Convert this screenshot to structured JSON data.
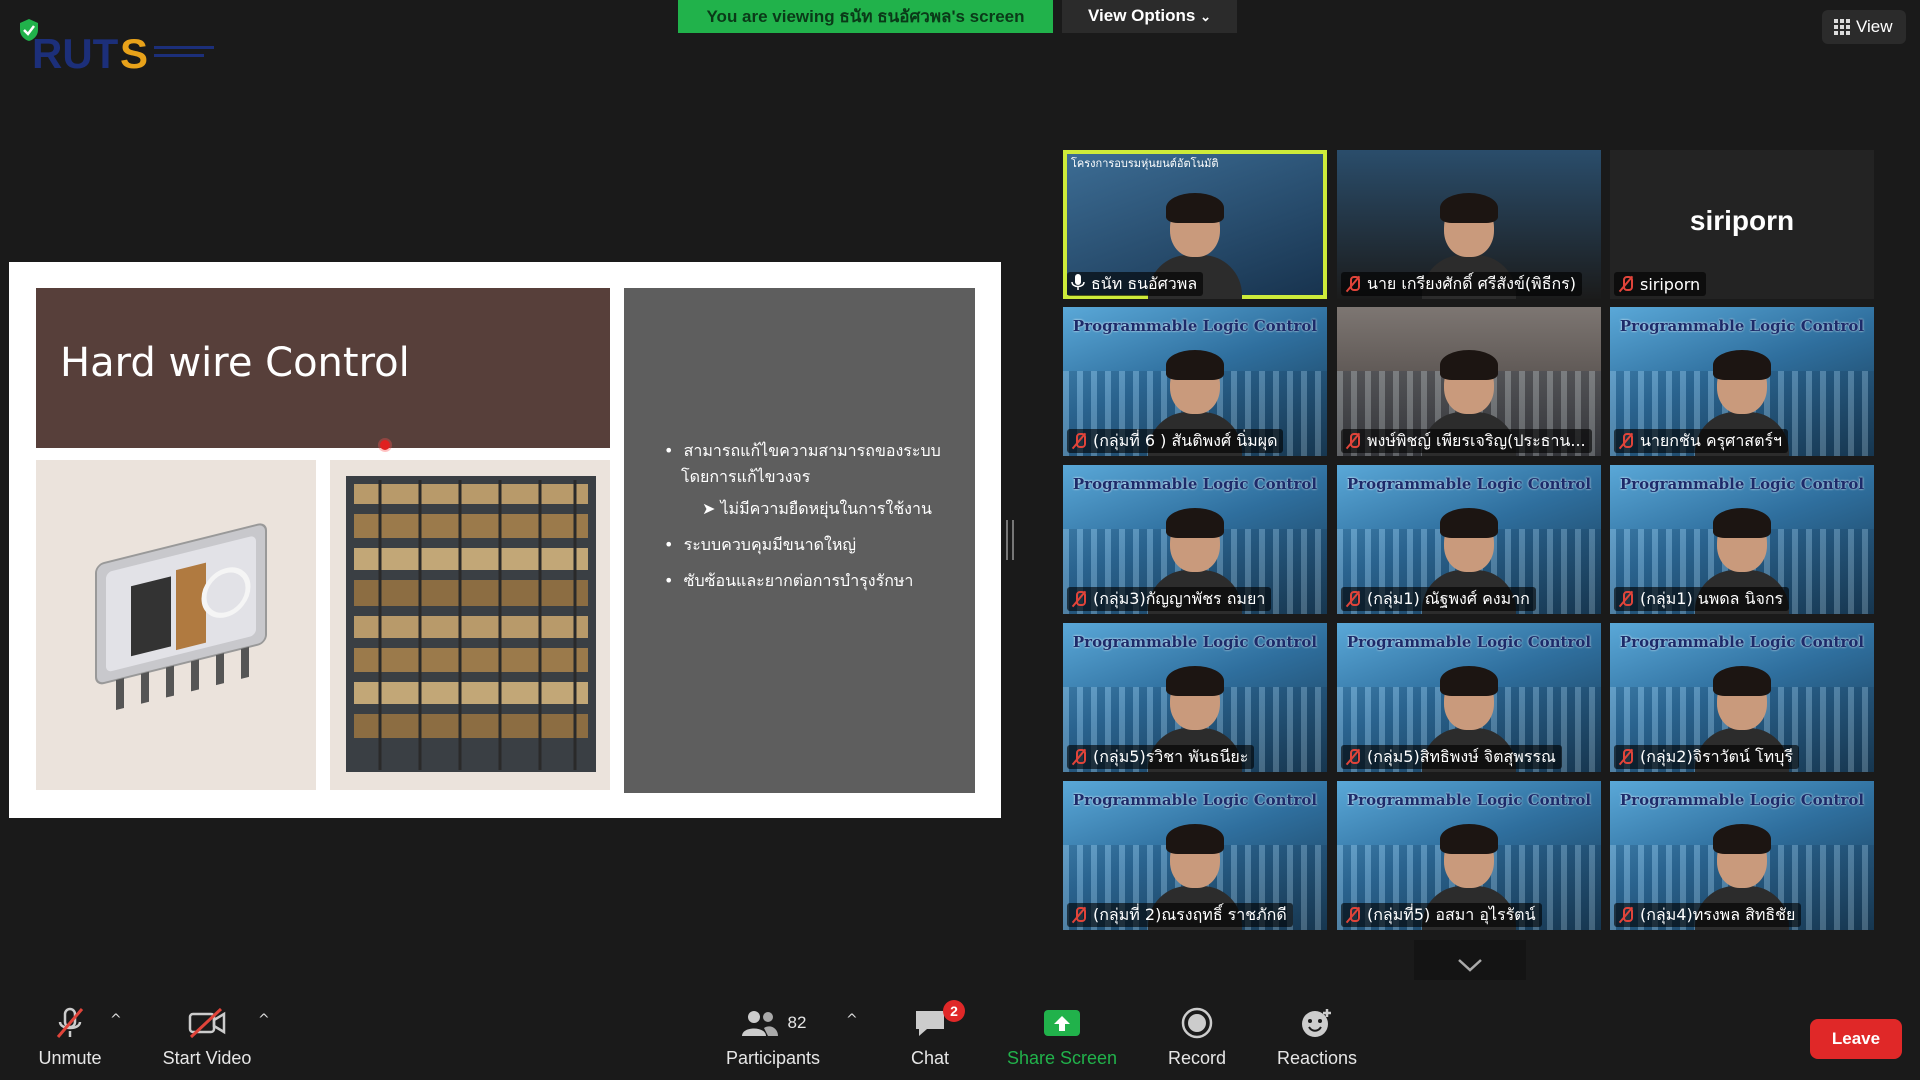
{
  "top": {
    "viewing_banner": "You are viewing ธนัท ธนอัศวพล's screen",
    "view_options": "View Options",
    "view_label": "View",
    "logo_text": "RUTS"
  },
  "slide": {
    "title": "Hard wire Control",
    "bullets": [
      "สามารถแก้ไขความสามารถของระบบ",
      "โดยการแก้ไขวงจร",
      "ไม่มีความยืดหยุ่นในการใช้งาน",
      "ระบบควบคุมมีขนาดใหญ่",
      "ซับซ้อนและยากต่อการบำรุงรักษา"
    ],
    "colors": {
      "title_bg": "#573f3a",
      "panel_bg": "#5e5e5e"
    }
  },
  "gallery": {
    "plc_caption": "Programmable Logic Control",
    "tiles": [
      {
        "name": "ธนัท ธนอัศวพล",
        "muted": false,
        "active": true,
        "overlay": "โครงการอบรมหุ่นยนต์อัตโนมัติ"
      },
      {
        "name": "นาย เกรียงศักดิ์ ศรีสังข์(พิธีกร)",
        "muted": true
      },
      {
        "name": "siriporn",
        "muted": true,
        "video_off": true,
        "display_name": "siriporn"
      },
      {
        "name": "(กลุ่มที่ 6 ) สันติพงศ์ นิ่มผุด",
        "muted": true
      },
      {
        "name": "พงษ์พิชญ์ เพียรเจริญ(ประธาน...",
        "muted": true
      },
      {
        "name": "นายกชัน ครุศาสตร์ฯ",
        "muted": true
      },
      {
        "name": "(กลุ่ม3)กัญญาพัชร ถมยา",
        "muted": true
      },
      {
        "name": "(กลุ่ม1) ณัฐพงศ์ คงมาก",
        "muted": true
      },
      {
        "name": "(กลุ่ม1) นพดล นิจกร",
        "muted": true
      },
      {
        "name": "(กลุ่ม5)รวิชา พันธนียะ",
        "muted": true
      },
      {
        "name": "(กลุ่ม5)สิทธิพงษ์ จิตสุพรรณ",
        "muted": true
      },
      {
        "name": "(กลุ่ม2)จิราวัตน์ โทบุรี",
        "muted": true
      },
      {
        "name": "(กลุ่มที่ 2)ณรงฤทธิ์ ราชภักดี",
        "muted": true
      },
      {
        "name": "(กลุ่มที่5) อสมา อุไรรัตน์",
        "muted": true
      },
      {
        "name": "(กลุ่ม4)ทรงพล สิทธิชัย",
        "muted": true
      }
    ]
  },
  "toolbar": {
    "unmute": "Unmute",
    "start_video": "Start Video",
    "participants": "Participants",
    "participants_count": "82",
    "chat": "Chat",
    "chat_badge": "2",
    "share_screen": "Share Screen",
    "record": "Record",
    "reactions": "Reactions",
    "leave": "Leave",
    "accent_share": "#21b24b",
    "leave_color": "#e02828"
  }
}
